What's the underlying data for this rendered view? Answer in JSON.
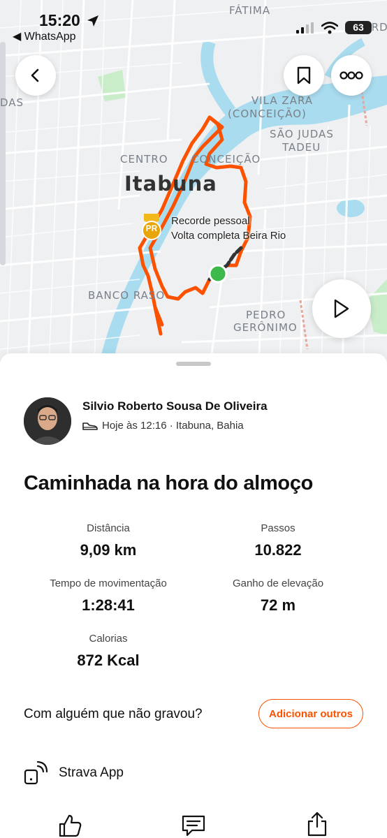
{
  "status_bar": {
    "time": "15:20",
    "back_app": "◀ WhatsApp",
    "battery": "63"
  },
  "map": {
    "city": "Itabuna",
    "neighborhoods": {
      "fatima": "FÁTIMA",
      "das": "DAS",
      "vila_zara_1": "VILA ZARA",
      "vila_zara_2": "(CONCEIÇÃO)",
      "sao_judas_1": "SÃO JUDAS",
      "sao_judas_2": "TADEU",
      "centro": "CENTRO",
      "conceicao": "CONCEIÇÃO",
      "banco_raso": "BANCO RASO",
      "pedro_1": "PEDRO",
      "pedro_2": "GERÔNIMO",
      "verde": "VERDE"
    },
    "pr_badge": "PR",
    "pr_title": "Recorde pessoal",
    "pr_segment": "Volta completa Beira Rio",
    "colors": {
      "route": "#fc5200",
      "start": "#3cb94a",
      "water": "#a9dcef",
      "park": "#c9ecc9"
    }
  },
  "activity": {
    "athlete": "Silvio Roberto Sousa De Oliveira",
    "meta": "Hoje às 12:16 · Itabuna, Bahia",
    "title": "Caminhada na hora do almoço",
    "stats": [
      {
        "label": "Distância",
        "value": "9,09 km"
      },
      {
        "label": "Passos",
        "value": "10.822"
      },
      {
        "label": "Tempo de movimentação",
        "value": "1:28:41"
      },
      {
        "label": "Ganho de elevação",
        "value": "72 m"
      },
      {
        "label": "Calorias",
        "value": "872 Kcal"
      }
    ],
    "with_others": "Com alguém que não gravou?",
    "add_others": "Adicionar outros",
    "device": "Strava App"
  },
  "icons": {
    "back": "chevron-left-icon",
    "bookmark": "bookmark-icon",
    "more": "more-icon",
    "play": "play-icon",
    "shoe": "shoe-icon",
    "device": "watch-icon",
    "like": "thumbs-up-icon",
    "comment": "comment-icon",
    "share": "share-icon"
  }
}
